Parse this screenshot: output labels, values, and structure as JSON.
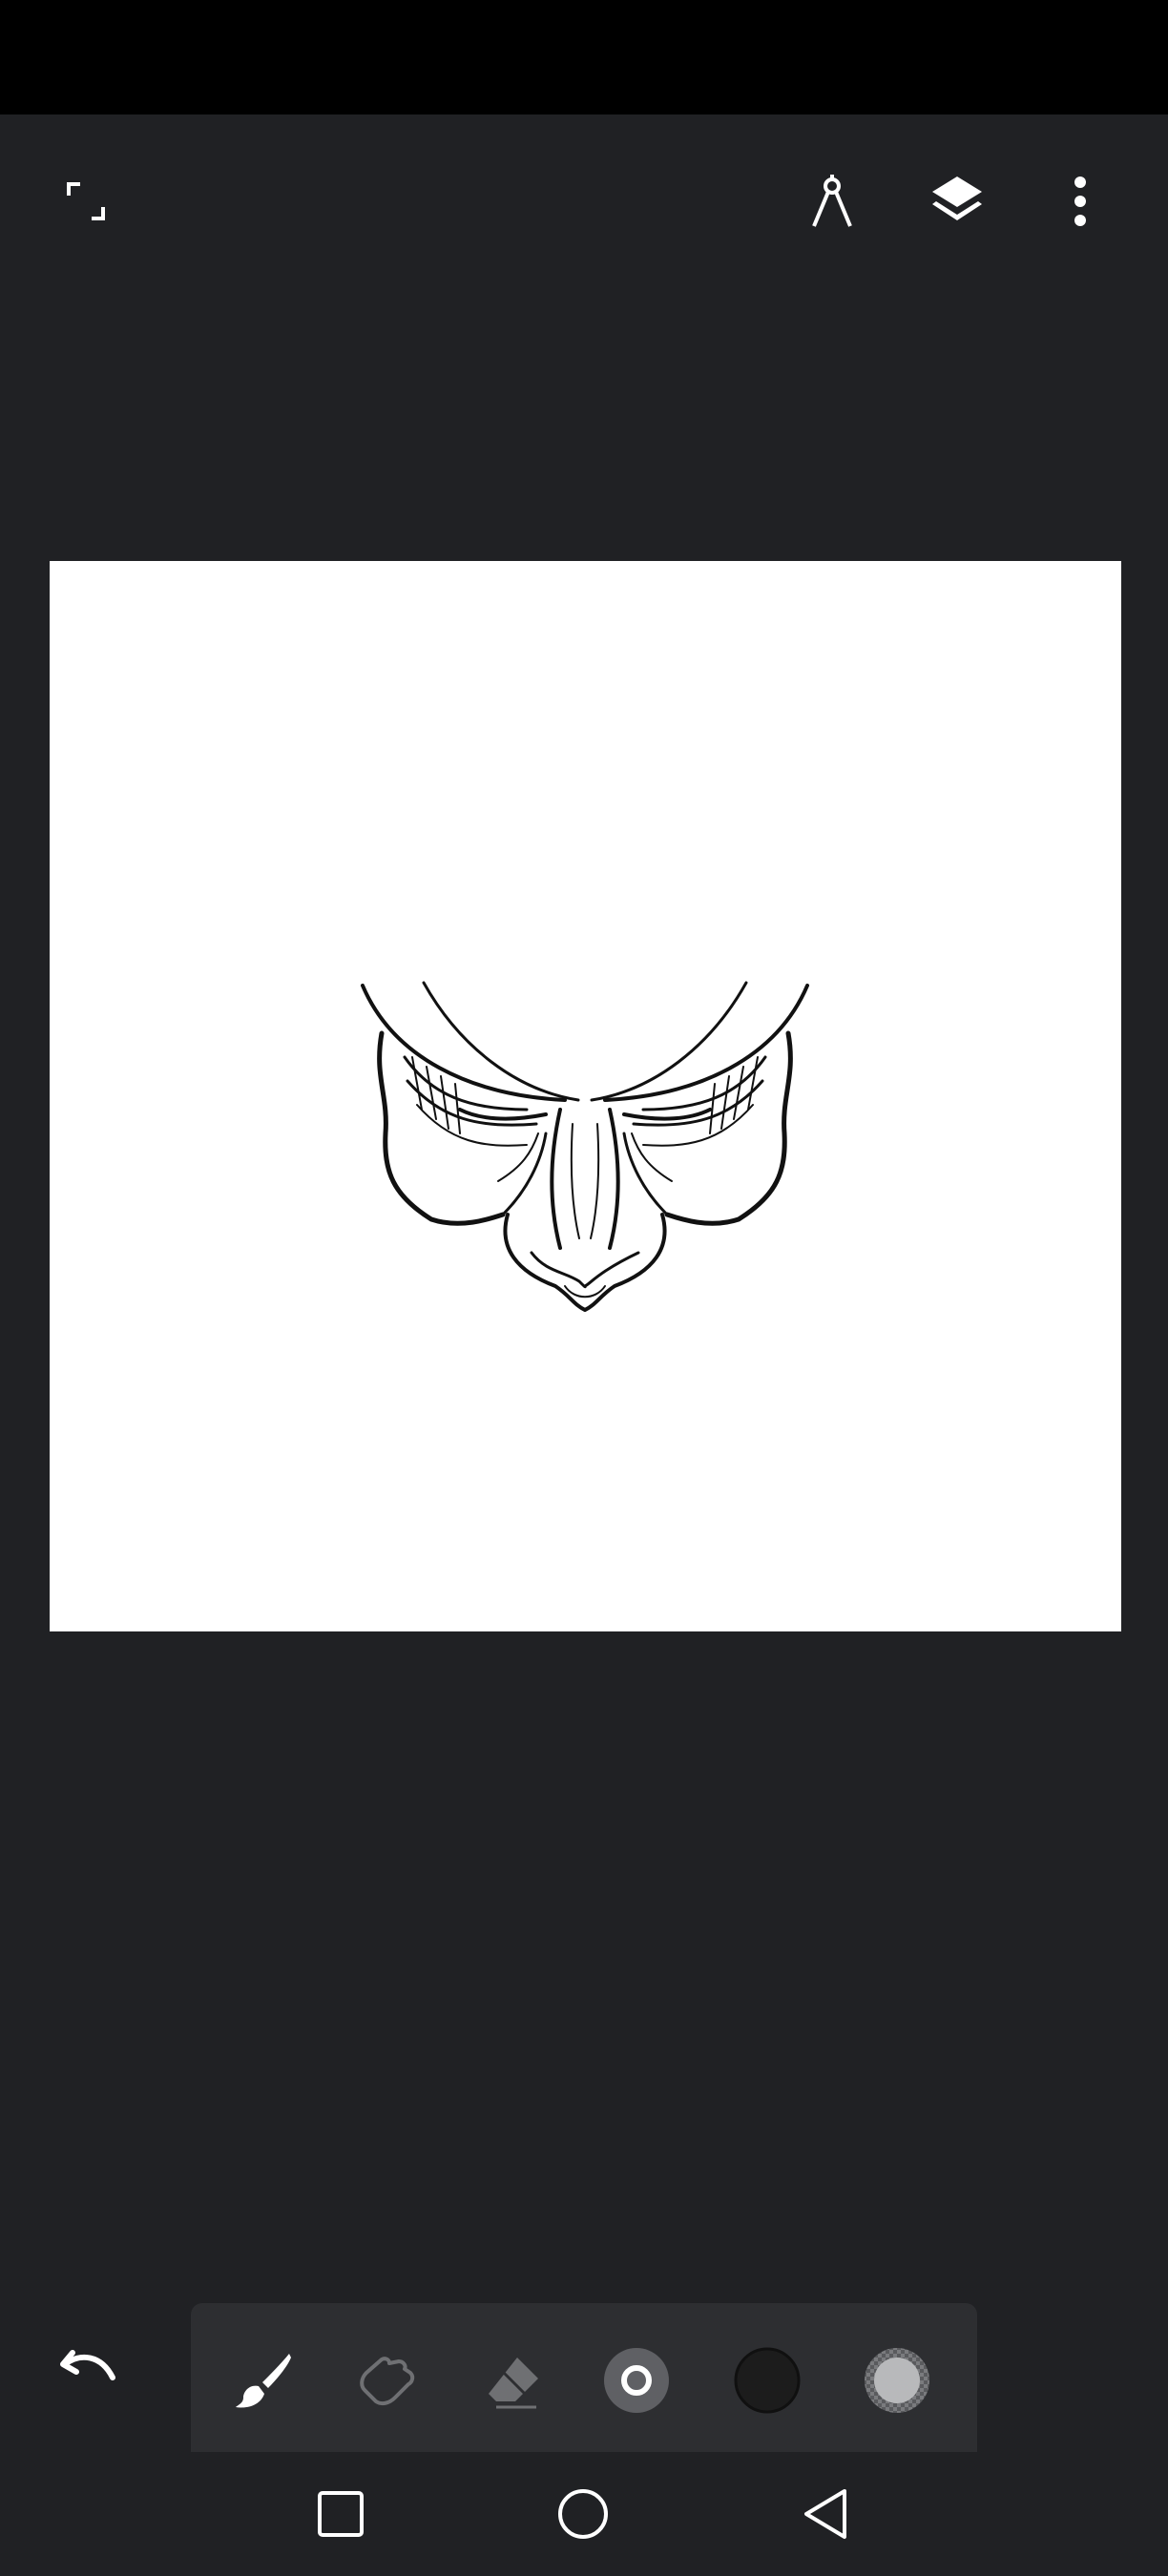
{
  "app": {
    "toolbar": {
      "left_icon": "fullscreen-toggle-icon",
      "right_icons": [
        "compass-ruler-icon",
        "layers-icon",
        "more-vert-icon"
      ]
    },
    "canvas": {
      "background_color": "#ffffff",
      "drawing_subject": "line-art-face"
    },
    "bottom_tools": [
      {
        "id": "brush",
        "icon": "brush-icon",
        "active": true
      },
      {
        "id": "smudge",
        "icon": "smudge-icon",
        "active": false
      },
      {
        "id": "eraser",
        "icon": "eraser-icon",
        "active": false
      },
      {
        "id": "brush-size",
        "icon": "brush-size-icon",
        "active": false
      },
      {
        "id": "color",
        "icon": "color-swatch-icon",
        "color": "#1c1c1c"
      },
      {
        "id": "opacity",
        "icon": "opacity-icon",
        "active": false
      }
    ],
    "undo_icon": "undo-icon"
  },
  "system_nav": {
    "icons": [
      "recents-square-icon",
      "home-circle-icon",
      "back-triangle-icon"
    ]
  },
  "colors": {
    "background": "#202124",
    "status_bar": "#000000",
    "tray": "#2d2e31",
    "icon": "#ffffff",
    "icon_dim": "#6f7073"
  }
}
